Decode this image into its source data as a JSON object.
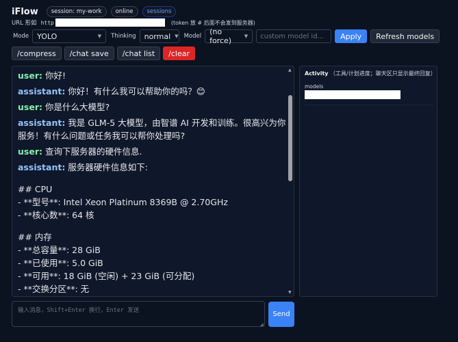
{
  "header": {
    "title": "iFlow",
    "pills": [
      "session: my-work",
      "online",
      "sessions"
    ]
  },
  "url_row": {
    "label": "URL 形如",
    "prefix": "http",
    "note": "(token 放 # 后面不会发到服务器)"
  },
  "controls": {
    "mode_label": "Mode",
    "mode_value": "YOLO",
    "thinking_label": "Thinking",
    "thinking_value": "normal",
    "model_label": "Model",
    "model_value": "(no force)",
    "custom_model_placeholder": "custom model id...",
    "apply_label": "Apply",
    "refresh_label": "Refresh models"
  },
  "commands": {
    "compress": "/compress",
    "chat_save": "/chat save",
    "chat_list": "/chat list",
    "clear": "/clear"
  },
  "chat": {
    "messages": [
      {
        "role": "user:",
        "text": " 你好!"
      },
      {
        "role": "assistant:",
        "text": " 你好！有什么我可以帮助你的吗？😊"
      },
      {
        "role": "user:",
        "text": " 你是什么大模型?"
      },
      {
        "role": "assistant:",
        "text": " 我是 GLM-5 大模型，由智谱 AI 开发和训练。很高兴为你服务！有什么问题或任务我可以帮你处理吗?"
      },
      {
        "role": "user:",
        "text": " 查询下服务器的硬件信息."
      },
      {
        "role": "assistant:",
        "text": " 服务器硬件信息如下:"
      }
    ],
    "body_lines": [
      "",
      "## CPU",
      "- **型号**: Intel Xeon Platinum 8369B @ 2.70GHz",
      "- **核心数**: 64 核",
      "",
      "## 内存",
      "- **总容量**: 28 GiB",
      "- **已使用**: 5.0 GiB",
      "- **可用**: 18 GiB (空闲) + 23 GiB (可分配)",
      "- **交换分区**: 无"
    ]
  },
  "activity": {
    "title": "Activity",
    "subtitle": "（工具/计划进度；聊天区只显示最终回复）",
    "item_label": "models"
  },
  "composer": {
    "placeholder": "输入消息，Shift+Enter 换行，Enter 发送",
    "send_label": "Send"
  }
}
